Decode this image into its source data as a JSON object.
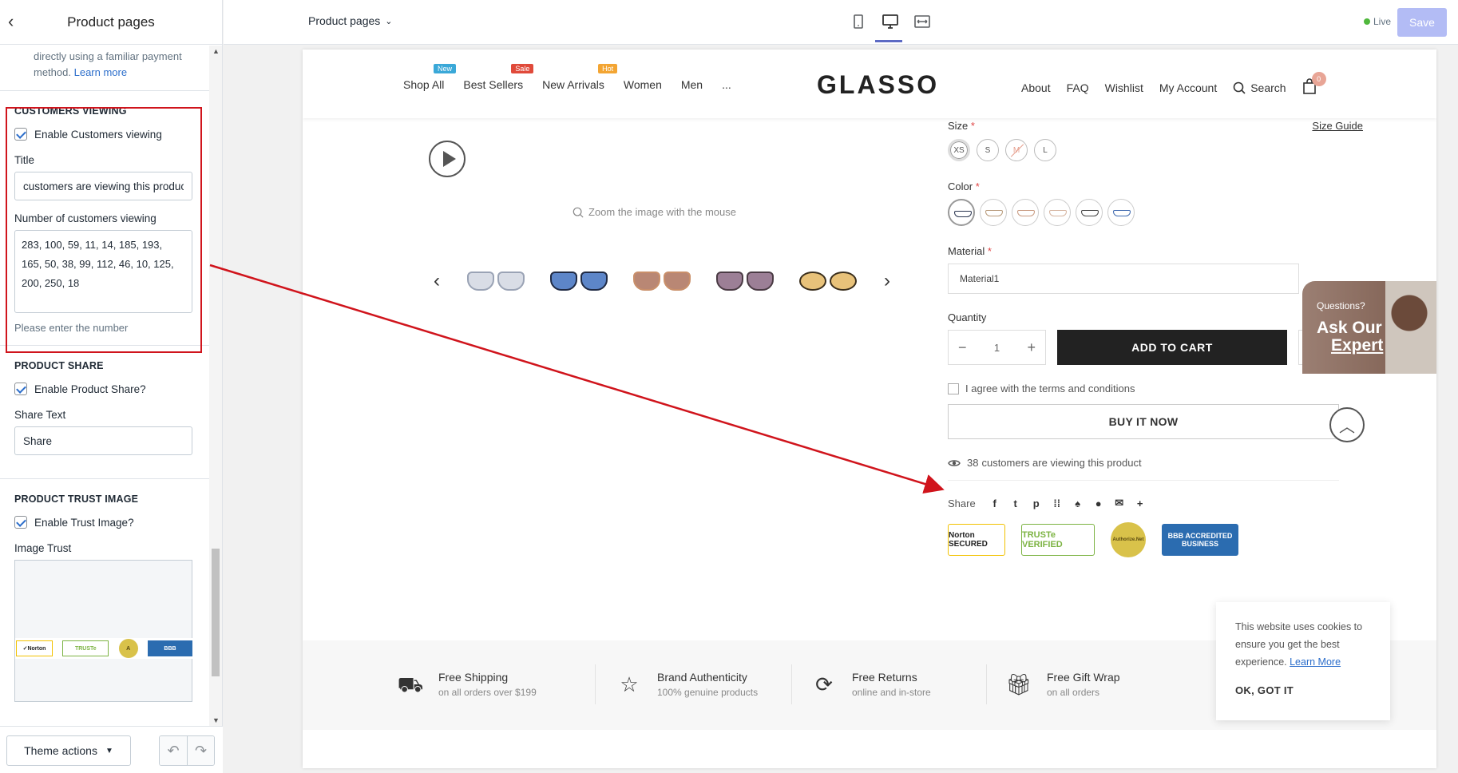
{
  "editor": {
    "title": "Product pages",
    "intro_text": "directly using a familiar payment method.",
    "intro_link": "Learn more",
    "customers_viewing": {
      "heading": "CUSTOMERS VIEWING",
      "enable_label": "Enable Customers viewing",
      "title_label": "Title",
      "title_value": "customers are viewing this product",
      "number_label": "Number of customers viewing",
      "number_value": "283, 100, 59, 11, 14, 185, 193, 165, 50, 38, 99, 112, 46, 10, 125, 200, 250, 18",
      "help": "Please enter the number"
    },
    "product_share": {
      "heading": "PRODUCT SHARE",
      "enable_label": "Enable Product Share?",
      "share_text_label": "Share Text",
      "share_text_value": "Share"
    },
    "trust_image": {
      "heading": "PRODUCT TRUST IMAGE",
      "enable_label": "Enable Trust Image?",
      "image_label": "Image Trust"
    },
    "footer": {
      "theme_actions": "Theme actions"
    }
  },
  "topbar": {
    "page_select": "Product pages",
    "live_label": "Live",
    "save_label": "Save"
  },
  "store": {
    "nav_left": [
      {
        "label": "Shop All",
        "badge": "New",
        "badge_color": "#3aa8d8"
      },
      {
        "label": "Best Sellers",
        "badge": "Sale",
        "badge_color": "#e04a3a"
      },
      {
        "label": "New Arrivals",
        "badge": "Hot",
        "badge_color": "#f3a533"
      },
      {
        "label": "Women"
      },
      {
        "label": "Men"
      },
      {
        "label": "..."
      }
    ],
    "logo": "GLASSO",
    "nav_right": [
      "About",
      "FAQ",
      "Wishlist",
      "My Account",
      "Search"
    ],
    "cart_count": "0",
    "zoom_hint": "Zoom the image with the mouse",
    "size_label": "Size",
    "size_guide": "Size Guide",
    "sizes": [
      "XS",
      "S",
      "M",
      "L"
    ],
    "color_label": "Color",
    "material_label": "Material",
    "material_value": "Material1",
    "quantity_label": "Quantity",
    "quantity_value": "1",
    "add_to_cart": "ADD TO CART",
    "terms": "I agree with the terms and conditions",
    "buy_now": "BUY IT NOW",
    "viewing_count": "38",
    "viewing_text": "customers are viewing this product",
    "share_label": "Share",
    "expert_q": "Questions?",
    "expert_a1": "Ask Our",
    "expert_a2": "Expert",
    "trust_badges": [
      "Norton SECURED",
      "TRUSTe VERIFIED",
      "Authorize.Net",
      "BBB ACCREDITED BUSINESS"
    ],
    "features": [
      {
        "title": "Free Shipping",
        "sub": "on all orders over $199",
        "icon": "truck-icon"
      },
      {
        "title": "Brand Authenticity",
        "sub": "100% genuine products",
        "icon": "star-icon"
      },
      {
        "title": "Free Returns",
        "sub": "online and in-store",
        "icon": "refresh-icon"
      },
      {
        "title": "Free Gift Wrap",
        "sub": "on all orders",
        "icon": "gift-icon"
      }
    ],
    "cookie_text": "This website uses cookies to ensure you get the best experience.",
    "cookie_link": "Learn More",
    "cookie_ok": "OK, GOT IT"
  }
}
